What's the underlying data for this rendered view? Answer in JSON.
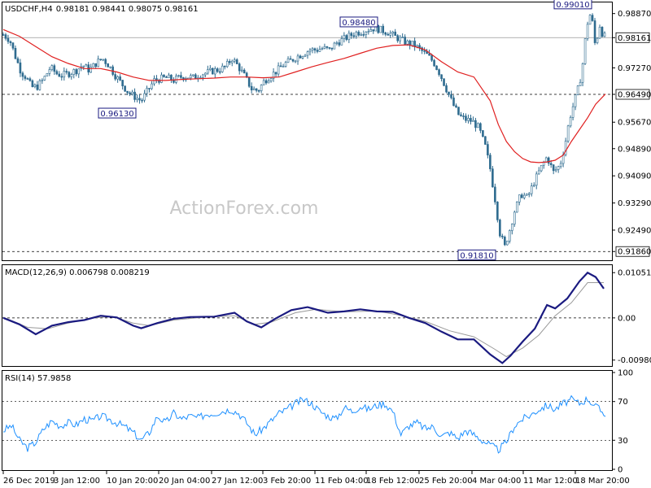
{
  "header": {
    "symbol": "USDCHF,H4",
    "ohlc": "0.98181 0.98441 0.98075 0.98161"
  },
  "watermark": "ActionForex.com",
  "colors": {
    "candle": "#2e6b8f",
    "ma": "#e02020",
    "macd": "#1a1a80",
    "signal": "#9a9a9a",
    "rsi": "#1e90ff",
    "label_border": "#1a1a80",
    "grid": "#000000"
  },
  "chart_data": [
    {
      "type": "candlestick",
      "title": "USDCHF,H4",
      "ylim": [
        0.9165,
        0.9915
      ],
      "y_ticks": [
        "0.98870",
        "0.98161",
        "0.97270",
        "0.96490",
        "0.95670",
        "0.94890",
        "0.94090",
        "0.93290",
        "0.92490",
        "0.91860"
      ],
      "x_ticks": [
        "26 Dec 2019",
        "3 Jan 12:00",
        "10 Jan 20:00",
        "20 Jan 04:00",
        "27 Jan 12:00",
        "3 Feb 20:00",
        "11 Feb 04:00",
        "18 Feb 12:00",
        "25 Feb 20:00",
        "4 Mar 04:00",
        "11 Mar 12:00",
        "18 Mar 20:00"
      ],
      "current_price": "0.98161",
      "horizontal_levels": [
        "0.96490",
        "0.91860"
      ],
      "annotations": [
        "0.99010",
        "0.98480",
        "0.96130",
        "0.91810"
      ],
      "price_path": [
        [
          0,
          0.9825
        ],
        [
          8,
          0.981
        ],
        [
          15,
          0.976
        ],
        [
          22,
          0.9715
        ],
        [
          28,
          0.97
        ],
        [
          35,
          0.967
        ],
        [
          42,
          0.9672
        ],
        [
          50,
          0.9695
        ],
        [
          58,
          0.9728
        ],
        [
          66,
          0.971
        ],
        [
          72,
          0.9705
        ],
        [
          80,
          0.971
        ],
        [
          90,
          0.972
        ],
        [
          98,
          0.9735
        ],
        [
          106,
          0.972
        ],
        [
          114,
          0.974
        ],
        [
          122,
          0.9755
        ],
        [
          130,
          0.9735
        ],
        [
          138,
          0.9705
        ],
        [
          146,
          0.968
        ],
        [
          154,
          0.9655
        ],
        [
          162,
          0.9642
        ],
        [
          170,
          0.963
        ],
        [
          178,
          0.966
        ],
        [
          186,
          0.969
        ],
        [
          194,
          0.9695
        ],
        [
          202,
          0.9698
        ],
        [
          210,
          0.969
        ],
        [
          218,
          0.97
        ],
        [
          226,
          0.9702
        ],
        [
          234,
          0.9698
        ],
        [
          242,
          0.9708
        ],
        [
          250,
          0.9712
        ],
        [
          258,
          0.9718
        ],
        [
          266,
          0.9722
        ],
        [
          274,
          0.973
        ],
        [
          282,
          0.9755
        ],
        [
          290,
          0.973
        ],
        [
          298,
          0.97
        ],
        [
          306,
          0.9665
        ],
        [
          314,
          0.966
        ],
        [
          322,
          0.969
        ],
        [
          330,
          0.9705
        ],
        [
          338,
          0.972
        ],
        [
          346,
          0.9738
        ],
        [
          354,
          0.9748
        ],
        [
          362,
          0.976
        ],
        [
          370,
          0.977
        ],
        [
          378,
          0.978
        ],
        [
          386,
          0.978
        ],
        [
          394,
          0.9785
        ],
        [
          402,
          0.978
        ],
        [
          410,
          0.98
        ],
        [
          418,
          0.981
        ],
        [
          426,
          0.982
        ],
        [
          434,
          0.983
        ],
        [
          442,
          0.9835
        ],
        [
          450,
          0.984
        ],
        [
          458,
          0.9845
        ],
        [
          466,
          0.9838
        ],
        [
          474,
          0.9832
        ],
        [
          482,
          0.982
        ],
        [
          490,
          0.981
        ],
        [
          498,
          0.98
        ],
        [
          506,
          0.9795
        ],
        [
          514,
          0.978
        ],
        [
          522,
          0.9765
        ],
        [
          530,
          0.9745
        ],
        [
          538,
          0.971
        ],
        [
          546,
          0.9665
        ],
        [
          554,
          0.962
        ],
        [
          562,
          0.9585
        ],
        [
          570,
          0.9575
        ],
        [
          578,
          0.957
        ],
        [
          586,
          0.955
        ],
        [
          594,
          0.9495
        ],
        [
          600,
          0.943
        ],
        [
          606,
          0.934
        ],
        [
          612,
          0.924
        ],
        [
          618,
          0.92
        ],
        [
          624,
          0.925
        ],
        [
          630,
          0.9305
        ],
        [
          638,
          0.9355
        ],
        [
          646,
          0.9345
        ],
        [
          654,
          0.939
        ],
        [
          662,
          0.943
        ],
        [
          670,
          0.9465
        ],
        [
          678,
          0.942
        ],
        [
          686,
          0.944
        ],
        [
          692,
          0.95
        ],
        [
          698,
          0.958
        ],
        [
          704,
          0.963
        ],
        [
          710,
          0.968
        ],
        [
          714,
          0.974
        ],
        [
          718,
          0.983
        ],
        [
          722,
          0.989
        ],
        [
          726,
          0.986
        ],
        [
          730,
          0.978
        ],
        [
          734,
          0.986
        ],
        [
          738,
          0.983
        ],
        [
          742,
          0.9816
        ]
      ],
      "ma_path": [
        [
          0,
          0.984
        ],
        [
          20,
          0.982
        ],
        [
          40,
          0.979
        ],
        [
          60,
          0.976
        ],
        [
          80,
          0.974
        ],
        [
          100,
          0.9725
        ],
        [
          120,
          0.9725
        ],
        [
          140,
          0.9715
        ],
        [
          160,
          0.97
        ],
        [
          180,
          0.969
        ],
        [
          200,
          0.969
        ],
        [
          220,
          0.9693
        ],
        [
          240,
          0.9695
        ],
        [
          260,
          0.9697
        ],
        [
          280,
          0.97
        ],
        [
          300,
          0.97
        ],
        [
          320,
          0.9698
        ],
        [
          340,
          0.97
        ],
        [
          360,
          0.9715
        ],
        [
          380,
          0.973
        ],
        [
          400,
          0.9743
        ],
        [
          420,
          0.9755
        ],
        [
          440,
          0.977
        ],
        [
          460,
          0.9785
        ],
        [
          480,
          0.9793
        ],
        [
          500,
          0.9795
        ],
        [
          520,
          0.978
        ],
        [
          540,
          0.9745
        ],
        [
          560,
          0.9715
        ],
        [
          580,
          0.97
        ],
        [
          600,
          0.963
        ],
        [
          610,
          0.956
        ],
        [
          620,
          0.951
        ],
        [
          630,
          0.948
        ],
        [
          640,
          0.946
        ],
        [
          650,
          0.945
        ],
        [
          660,
          0.9448
        ],
        [
          670,
          0.945
        ],
        [
          680,
          0.9455
        ],
        [
          690,
          0.947
        ],
        [
          700,
          0.951
        ],
        [
          710,
          0.9545
        ],
        [
          720,
          0.958
        ],
        [
          730,
          0.962
        ],
        [
          742,
          0.965
        ]
      ]
    },
    {
      "type": "line",
      "title": "MACD(12,26,9) 0.006798 0.008219",
      "y_ticks": [
        "0.010513",
        "0.00",
        "-0.009804"
      ],
      "ylim": [
        -0.0108,
        0.0115
      ],
      "series": [
        {
          "name": "MACD",
          "points": [
            [
              0,
              0.0
            ],
            [
              20,
              -0.0015
            ],
            [
              40,
              -0.0038
            ],
            [
              60,
              -0.0018
            ],
            [
              80,
              -0.001
            ],
            [
              100,
              -0.0005
            ],
            [
              120,
              0.0005
            ],
            [
              140,
              0.0001
            ],
            [
              160,
              -0.0018
            ],
            [
              170,
              -0.0024
            ],
            [
              190,
              -0.0012
            ],
            [
              210,
              -0.0002
            ],
            [
              230,
              0.0002
            ],
            [
              260,
              0.0003
            ],
            [
              285,
              0.0012
            ],
            [
              300,
              -0.0008
            ],
            [
              318,
              -0.0022
            ],
            [
              335,
              -0.0002
            ],
            [
              355,
              0.0018
            ],
            [
              375,
              0.0025
            ],
            [
              400,
              0.0012
            ],
            [
              420,
              0.0015
            ],
            [
              440,
              0.002
            ],
            [
              460,
              0.0015
            ],
            [
              480,
              0.0014
            ],
            [
              500,
              0.0
            ],
            [
              520,
              -0.0012
            ],
            [
              540,
              -0.0032
            ],
            [
              560,
              -0.005
            ],
            [
              580,
              -0.005
            ],
            [
              600,
              -0.0085
            ],
            [
              615,
              -0.0105
            ],
            [
              625,
              -0.0088
            ],
            [
              640,
              -0.0055
            ],
            [
              655,
              -0.0025
            ],
            [
              670,
              0.003
            ],
            [
              680,
              0.0022
            ],
            [
              695,
              0.0045
            ],
            [
              710,
              0.0085
            ],
            [
              720,
              0.0105
            ],
            [
              730,
              0.0095
            ],
            [
              740,
              0.0068
            ]
          ]
        },
        {
          "name": "Signal",
          "points": [
            [
              0,
              0.0002
            ],
            [
              30,
              -0.0022
            ],
            [
              55,
              -0.0025
            ],
            [
              80,
              -0.0012
            ],
            [
              110,
              0.0
            ],
            [
              135,
              0.0003
            ],
            [
              160,
              -0.0012
            ],
            [
              180,
              -0.0018
            ],
            [
              210,
              -0.0005
            ],
            [
              250,
              0.0002
            ],
            [
              285,
              0.0005
            ],
            [
              310,
              -0.0015
            ],
            [
              330,
              -0.001
            ],
            [
              360,
              0.0012
            ],
            [
              385,
              0.002
            ],
            [
              420,
              0.0014
            ],
            [
              460,
              0.0016
            ],
            [
              490,
              0.0006
            ],
            [
              520,
              -0.0008
            ],
            [
              550,
              -0.003
            ],
            [
              580,
              -0.0044
            ],
            [
              605,
              -0.0072
            ],
            [
              620,
              -0.009
            ],
            [
              640,
              -0.007
            ],
            [
              660,
              -0.004
            ],
            [
              680,
              0.0005
            ],
            [
              700,
              0.0035
            ],
            [
              720,
              0.0082
            ],
            [
              740,
              0.0082
            ]
          ]
        }
      ]
    },
    {
      "type": "line",
      "title": "RSI(14) 57.9858",
      "y_ticks": [
        "100",
        "70",
        "30",
        "0"
      ],
      "levels": [
        "70",
        "30"
      ],
      "ylim": [
        0,
        100
      ],
      "series": [
        {
          "name": "RSI",
          "points": [
            [
              0,
              40
            ],
            [
              10,
              45
            ],
            [
              20,
              30
            ],
            [
              30,
              22
            ],
            [
              40,
              28
            ],
            [
              50,
              42
            ],
            [
              60,
              50
            ],
            [
              70,
              45
            ],
            [
              80,
              48
            ],
            [
              90,
              46
            ],
            [
              100,
              52
            ],
            [
              110,
              50
            ],
            [
              120,
              55
            ],
            [
              130,
              52
            ],
            [
              140,
              48
            ],
            [
              150,
              44
            ],
            [
              160,
              38
            ],
            [
              170,
              30
            ],
            [
              180,
              38
            ],
            [
              190,
              55
            ],
            [
              200,
              48
            ],
            [
              210,
              58
            ],
            [
              220,
              52
            ],
            [
              230,
              55
            ],
            [
              240,
              53
            ],
            [
              250,
              57
            ],
            [
              260,
              58
            ],
            [
              270,
              60
            ],
            [
              280,
              62
            ],
            [
              290,
              58
            ],
            [
              300,
              48
            ],
            [
              310,
              36
            ],
            [
              320,
              42
            ],
            [
              330,
              50
            ],
            [
              340,
              58
            ],
            [
              350,
              62
            ],
            [
              360,
              68
            ],
            [
              370,
              72
            ],
            [
              380,
              68
            ],
            [
              390,
              60
            ],
            [
              400,
              55
            ],
            [
              410,
              52
            ],
            [
              420,
              64
            ],
            [
              430,
              60
            ],
            [
              440,
              65
            ],
            [
              450,
              62
            ],
            [
              460,
              66
            ],
            [
              470,
              68
            ],
            [
              480,
              60
            ],
            [
              490,
              36
            ],
            [
              500,
              45
            ],
            [
              510,
              48
            ],
            [
              520,
              42
            ],
            [
              530,
              44
            ],
            [
              540,
              34
            ],
            [
              550,
              38
            ],
            [
              560,
              32
            ],
            [
              570,
              40
            ],
            [
              580,
              36
            ],
            [
              590,
              30
            ],
            [
              600,
              25
            ],
            [
              610,
              20
            ],
            [
              620,
              28
            ],
            [
              630,
              45
            ],
            [
              640,
              52
            ],
            [
              650,
              56
            ],
            [
              660,
              62
            ],
            [
              670,
              66
            ],
            [
              680,
              62
            ],
            [
              690,
              68
            ],
            [
              700,
              72
            ],
            [
              710,
              68
            ],
            [
              720,
              73
            ],
            [
              730,
              65
            ],
            [
              740,
              58
            ]
          ]
        }
      ]
    }
  ]
}
